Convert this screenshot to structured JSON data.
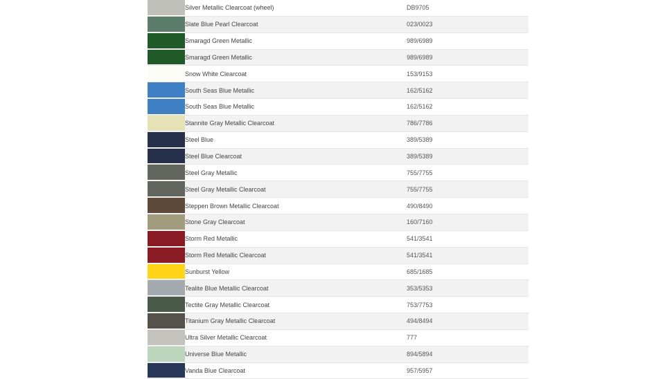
{
  "colors": [
    {
      "name": "Silver Metallic Clearcoat (wheel)",
      "code": "DB9705",
      "swatch": "#c0c0bb"
    },
    {
      "name": "Slate Blue Pearl Clearcoat",
      "code": "023/0023",
      "swatch": "#5c7c6c"
    },
    {
      "name": "Smaragd Green Metallic",
      "code": "989/6989",
      "swatch": "#1f5a28"
    },
    {
      "name": "Smaragd Green Metallic",
      "code": "989/6989",
      "swatch": "#1f5a28"
    },
    {
      "name": "Snow White Clearcoat",
      "code": "153/9153",
      "swatch": "#fdfdf8"
    },
    {
      "name": "South Seas Blue Metallic",
      "code": "162/5162",
      "swatch": "#3f7fc4"
    },
    {
      "name": "South Seas Blue Metallic",
      "code": "162/5162",
      "swatch": "#3f7fc4"
    },
    {
      "name": "Stannite Gray Metallic Clearcoat",
      "code": "786/7786",
      "swatch": "#e6e2b6"
    },
    {
      "name": "Steel Blue",
      "code": "389/5389",
      "swatch": "#27304a"
    },
    {
      "name": "Steel Blue Clearcoat",
      "code": "389/5389",
      "swatch": "#27304a"
    },
    {
      "name": "Steel Gray Metallic",
      "code": "755/7755",
      "swatch": "#63665e"
    },
    {
      "name": "Steel Gray Metallic Clearcoat",
      "code": "755/7755",
      "swatch": "#63665e"
    },
    {
      "name": "Steppen Brown Metallic Clearcoat",
      "code": "490/8490",
      "swatch": "#5e4a3a"
    },
    {
      "name": "Stone Gray Clearcoat",
      "code": "160/7160",
      "swatch": "#a29c7e"
    },
    {
      "name": "Storm Red Metallic",
      "code": "541/3541",
      "swatch": "#8a1a24"
    },
    {
      "name": "Storm Red Metallic Clearcoat",
      "code": "541/3541",
      "swatch": "#8a1a24"
    },
    {
      "name": "Sunburst Yellow",
      "code": "685/1685",
      "swatch": "#ffd419"
    },
    {
      "name": "Tealite Blue Metallic Clearcoat",
      "code": "353/5353",
      "swatch": "#a3aab0"
    },
    {
      "name": "Tectite Gray Metallic Clearcoat",
      "code": "753/7753",
      "swatch": "#4a5a48"
    },
    {
      "name": "Titanium Gray Metallic Clearcoat",
      "code": "494/8494",
      "swatch": "#54524a"
    },
    {
      "name": "Ultra Silver Metallic Clearcoat",
      "code": "777",
      "swatch": "#c4c2bc"
    },
    {
      "name": "Universe Blue Metallic",
      "code": "894/5894",
      "swatch": "#bcd6be"
    },
    {
      "name": "Vanda Blue Clearcoat",
      "code": "957/5957",
      "swatch": "#283658"
    }
  ]
}
